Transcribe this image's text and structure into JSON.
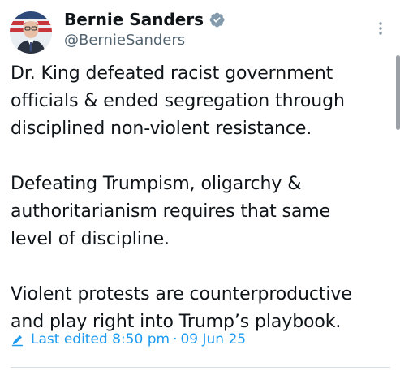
{
  "author": {
    "display_name": "Bernie Sanders",
    "handle": "@BernieSanders",
    "verified": true,
    "avatar_icon": "avatar-photo"
  },
  "tweet": {
    "paragraphs": [
      "Dr. King defeated racist government\nofficials & ended segregation through\ndisciplined non-violent resistance.",
      "Defeating Trumpism, oligarchy &\nauthoritarianism requires that same\nlevel of discipline.",
      "Violent protests are counterproductive\nand play right into Trump’s playbook."
    ]
  },
  "edited": {
    "label": "Last edited",
    "time": "8:50 pm",
    "separator": "·",
    "date": "09 Jun 25",
    "icon": "pencil-icon"
  },
  "colors": {
    "accent": "#1d9bf0",
    "text": "#0f1419",
    "secondary": "#536471",
    "verified": "#829aab"
  },
  "icons": {
    "more": "more-vertical-icon",
    "verified": "verified-badge-icon"
  }
}
